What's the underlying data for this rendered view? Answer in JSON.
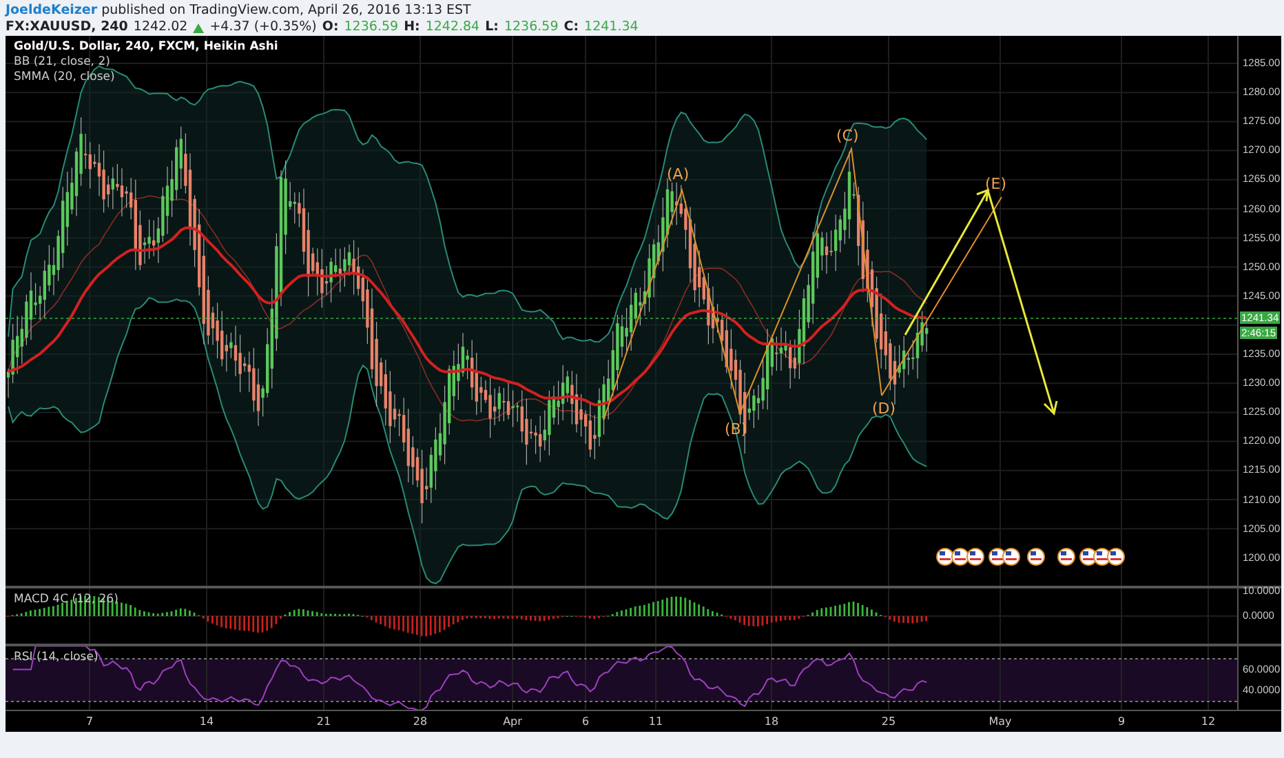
{
  "header": {
    "author": "JoeldeKeizer",
    "byline": "published on TradingView.com, April 26, 2016 13:13 EST"
  },
  "quote": {
    "symbol": "FX:XAUUSD, 240",
    "last": "1242.02",
    "rising": true,
    "change": "+4.37 (+0.35%)",
    "fields": [
      {
        "label": "O:",
        "value": "1236.59"
      },
      {
        "label": "H:",
        "value": "1242.84"
      },
      {
        "label": "L:",
        "value": "1236.59"
      },
      {
        "label": "C:",
        "value": "1241.34"
      }
    ]
  },
  "main_pane": {
    "legend": [
      "Gold/U.S. Dollar, 240, FXCM, Heikin Ashi",
      "BB (21, close, 2)",
      "SMMA (20, close)"
    ],
    "annotations": [
      "(A)",
      "(B)",
      "(C)",
      "(D)",
      "(E)"
    ],
    "price_axis": [
      "1285.00",
      "1280.00",
      "1275.00",
      "1270.00",
      "1265.00",
      "1260.00",
      "1255.00",
      "1250.00",
      "1245.00",
      "1235.00",
      "1230.00",
      "1225.00",
      "1220.00",
      "1215.00",
      "1210.00",
      "1205.00",
      "1200.00"
    ],
    "last_price": "1241.34",
    "countdown": "2:46:15"
  },
  "macd_pane": {
    "title": "MACD 4C (12, 26)",
    "axis": [
      "10.0000",
      "0.0000"
    ]
  },
  "rsi_pane": {
    "title": "RSI (14, close)",
    "axis": [
      "60.0000",
      "40.0000"
    ]
  },
  "time_axis": [
    "7",
    "14",
    "21",
    "28",
    "Apr",
    "6",
    "11",
    "18",
    "25",
    "May",
    "9",
    "12"
  ]
}
